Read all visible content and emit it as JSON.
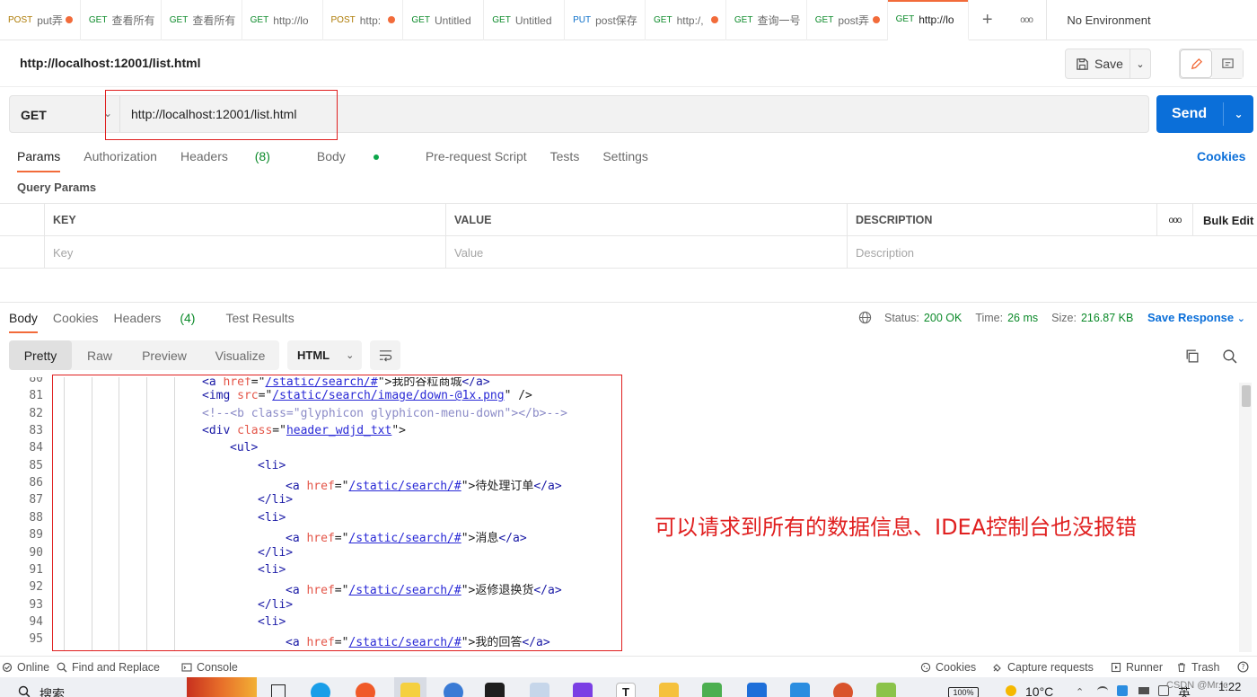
{
  "tabs": [
    {
      "method": "POST",
      "name": "put弄",
      "dot": true
    },
    {
      "method": "GET",
      "name": "查看所有",
      "dot": false
    },
    {
      "method": "GET",
      "name": "查看所有",
      "dot": false
    },
    {
      "method": "GET",
      "name": "http://lo",
      "dot": false
    },
    {
      "method": "POST",
      "name": "http:",
      "dot": true
    },
    {
      "method": "GET",
      "name": "Untitled",
      "dot": false
    },
    {
      "method": "GET",
      "name": "Untitled",
      "dot": false
    },
    {
      "method": "PUT",
      "name": "post保存",
      "dot": false
    },
    {
      "method": "GET",
      "name": "http:/,",
      "dot": true
    },
    {
      "method": "GET",
      "name": "查询一号",
      "dot": false
    },
    {
      "method": "GET",
      "name": "post弄",
      "dot": true
    },
    {
      "method": "GET",
      "name": "http://lo",
      "dot": false
    }
  ],
  "tabbar": {
    "add_icon": "+",
    "more_icon": "ooo",
    "environment": "No Environment"
  },
  "request": {
    "title": "http://localhost:12001/list.html",
    "save_label": "Save",
    "method": "GET",
    "url": "http://localhost:12001/list.html",
    "send_label": "Send"
  },
  "request_tabs": {
    "params": "Params",
    "authorization": "Authorization",
    "headers": "Headers",
    "headers_count": "(8)",
    "body": "Body",
    "prerequest": "Pre-request Script",
    "tests": "Tests",
    "settings": "Settings",
    "cookies": "Cookies"
  },
  "query_params": {
    "title": "Query Params",
    "columns": [
      "KEY",
      "VALUE",
      "DESCRIPTION"
    ],
    "more": "ooo",
    "bulk_edit": "Bulk Edit",
    "placeholders": [
      "Key",
      "Value",
      "Description"
    ]
  },
  "response_tabs": {
    "body": "Body",
    "cookies": "Cookies",
    "headers": "Headers",
    "headers_count": "(4)",
    "test_results": "Test Results"
  },
  "response_status": {
    "status_label": "Status:",
    "status_value": "200 OK",
    "time_label": "Time:",
    "time_value": "26 ms",
    "size_label": "Size:",
    "size_value": "216.87 KB",
    "save_response": "Save Response"
  },
  "view_modes": [
    "Pretty",
    "Raw",
    "Preview",
    "Visualize"
  ],
  "language": "HTML",
  "code": {
    "lines": [
      {
        "n": "80",
        "indent": 5
      },
      {
        "n": "81",
        "indent": 5
      },
      {
        "n": "82",
        "indent": 5
      },
      {
        "n": "83",
        "indent": 5
      },
      {
        "n": "84",
        "indent": 6
      },
      {
        "n": "85",
        "indent": 7
      },
      {
        "n": "86",
        "indent": 8
      },
      {
        "n": "87",
        "indent": 7
      },
      {
        "n": "88",
        "indent": 7
      },
      {
        "n": "89",
        "indent": 8
      },
      {
        "n": "90",
        "indent": 7
      },
      {
        "n": "91",
        "indent": 7
      },
      {
        "n": "92",
        "indent": 8
      },
      {
        "n": "93",
        "indent": 7
      },
      {
        "n": "94",
        "indent": 7
      },
      {
        "n": "95",
        "indent": 8
      }
    ],
    "text": {
      "l80": [
        "<a ",
        "href",
        "=\"",
        "/static/search/#",
        "\">",
        "我的谷粒商城",
        "</a>"
      ],
      "l81": [
        "<img ",
        "src",
        "=\"",
        "/static/search/image/down-@1x.png",
        "\" />"
      ],
      "l82": "<!--<b class=\"glyphicon glyphicon-menu-down\"></b>-->",
      "l83": [
        "<div ",
        "class",
        "=\"",
        "header_wdjd_txt",
        "\">"
      ],
      "l84": "<ul>",
      "l85": "<li>",
      "l86": [
        "<a ",
        "href",
        "=\"",
        "/static/search/#",
        "\">",
        "待处理订单",
        "</a>"
      ],
      "l87": "</li>",
      "l88": "<li>",
      "l89": [
        "<a ",
        "href",
        "=\"",
        "/static/search/#",
        "\">",
        "消息",
        "</a>"
      ],
      "l90": "</li>",
      "l91": "<li>",
      "l92": [
        "<a ",
        "href",
        "=\"",
        "/static/search/#",
        "\">",
        "返修退换货",
        "</a>"
      ],
      "l93": "</li>",
      "l94": "<li>",
      "l95": [
        "<a ",
        "href",
        "=\"",
        "/static/search/#",
        "\">",
        "我的回答",
        "</a>"
      ]
    }
  },
  "annotation": "可以请求到所有的数据信息、IDEA控制台也没报错",
  "statusbar": {
    "online": "Online",
    "find_replace": "Find and Replace",
    "console": "Console",
    "cookies": "Cookies",
    "capture": "Capture requests",
    "runner": "Runner",
    "trash": "Trash"
  },
  "taskbar": {
    "search": "搜索",
    "battery": "100%",
    "temperature": "10°C",
    "lang": "英",
    "time": "1:22",
    "watermark": "CSDN @Mr.lc"
  },
  "colors": {
    "accent": "#f26b3a",
    "send": "#0b6fd9",
    "status_ok": "#0c8a2a",
    "annotation": "#e02020"
  }
}
